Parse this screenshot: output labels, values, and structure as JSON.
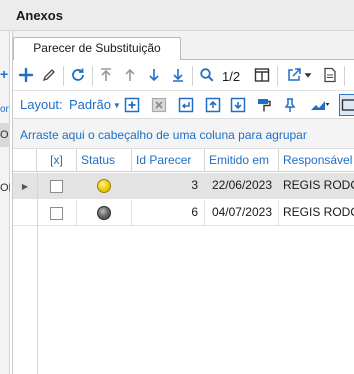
{
  "window": {
    "title": "Anexos"
  },
  "tabs": [
    {
      "label": "Parecer de Substituição",
      "active": true
    }
  ],
  "toolbar": {
    "pager": "1/2",
    "icons": [
      "add-icon",
      "edit-icon",
      "refresh-icon",
      "move-first-icon",
      "move-up-icon",
      "move-down-icon",
      "move-last-icon",
      "search-icon",
      "columns-icon",
      "export-icon",
      "dropdown-icon",
      "document-icon"
    ]
  },
  "layout": {
    "label": "Layout:",
    "value": "Padrão"
  },
  "grid": {
    "group_hint": "Arraste aqui o cabeçalho de uma coluna para agrupar",
    "columns": [
      "[x]",
      "Status",
      "Id Parecer",
      "Emitido em",
      "Responsável"
    ],
    "rows": [
      {
        "checked": false,
        "status": "yellow",
        "id": "3",
        "date": "22/06/2023",
        "responsible": "REGIS RODOL"
      },
      {
        "checked": false,
        "status": "gray",
        "id": "6",
        "date": "04/07/2023",
        "responsible": "REGIS RODOL"
      }
    ]
  },
  "colors": {
    "accent": "#1e6fc5",
    "selected_row": "#e3e3e3",
    "status_yellow": "#f2d11a",
    "status_gray": "#5a5a5a"
  },
  "left_strip": {
    "item_top": "or",
    "item_sel": "O",
    "item_bottom": "OD"
  }
}
